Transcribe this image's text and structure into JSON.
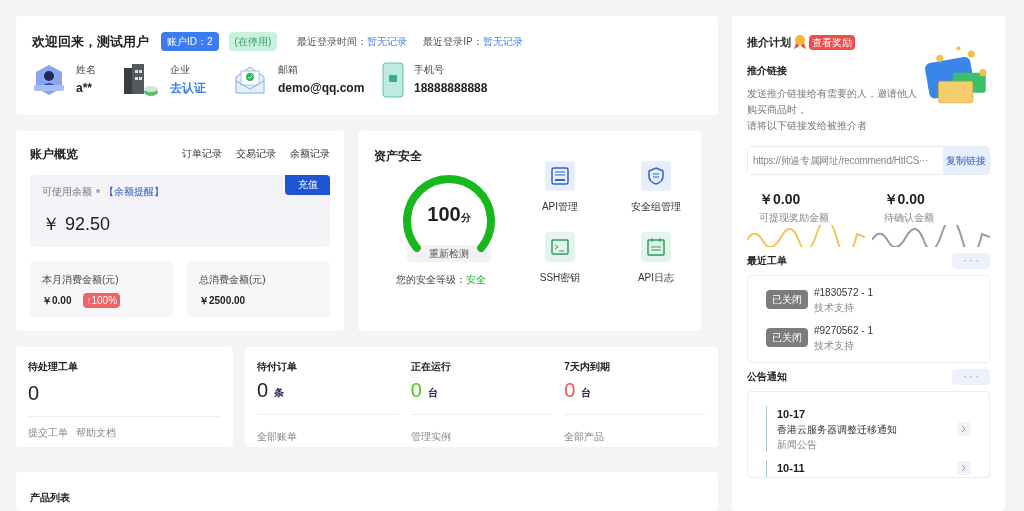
{
  "welcome": {
    "title": "欢迎回来，测试用户",
    "account_id": "账户ID：2",
    "status_badge": "(在停用)",
    "login_time_label": "最近登录时间：",
    "login_time": "暂无记录",
    "login_ip_label": "最近登录IP：",
    "login_ip": "暂无记录"
  },
  "profile": [
    {
      "kind": "user",
      "label": "姓名",
      "value": "a**",
      "link": false
    },
    {
      "kind": "company",
      "label": "企业",
      "value": "去认证",
      "link": true
    },
    {
      "kind": "mail",
      "label": "邮箱",
      "value": "demo@qq.com",
      "link": false
    },
    {
      "kind": "phone",
      "label": "手机号",
      "value": "18888888888",
      "link": false
    }
  ],
  "account": {
    "title": "账户概览",
    "tabs": [
      "订单记录",
      "交易记录",
      "余额记录"
    ],
    "balance_label": "可使用余额",
    "reminder": "【余额提醒】",
    "recharge": "充值",
    "balance": "￥ 92.50",
    "stats": [
      {
        "label": "本月消费金额(元)",
        "value": "￥0.00",
        "badge": "↑100%"
      },
      {
        "label": "总消费金额(元)",
        "value": "￥2500.00"
      }
    ]
  },
  "security": {
    "title": "资产安全",
    "score": "100",
    "unit": "分",
    "level": 1,
    "recheck": "重新检测",
    "grade_label": "您的安全等级：",
    "grade": "安全",
    "tools": [
      {
        "kind": "api",
        "label": "API管理"
      },
      {
        "kind": "shield",
        "label": "安全组管理"
      },
      {
        "kind": "terminal",
        "label": "SSH密钥"
      },
      {
        "kind": "log",
        "label": "API日志"
      }
    ]
  },
  "pending_tickets": {
    "title": "待处理工单",
    "count": "0",
    "links": [
      "提交工单",
      "帮助文档"
    ]
  },
  "summary": [
    {
      "title": "待付订单",
      "count": "0",
      "unit": "条",
      "color": "#222222",
      "link": "全部账单"
    },
    {
      "title": "正在运行",
      "count": "0",
      "unit": "台",
      "color": "#52c41a",
      "link": "管理实例"
    },
    {
      "title": "7天内到期",
      "count": "0",
      "unit": "台",
      "color": "#f0505a",
      "link": "全部产品"
    }
  ],
  "products": {
    "title": "产品列表"
  },
  "referral": {
    "title": "推介计划",
    "reward": "查看奖励",
    "link_title": "推介链接",
    "description": [
      "发送推介链接给有需要的人，邀请他人",
      "购买商品时，",
      "请将以下链接发给被推介者"
    ],
    "url": "https://帅逼专属网址/recommend/HtICS···",
    "copy": "复制链接",
    "amounts": [
      {
        "value": "￥0.00",
        "label": "可提现奖励金额",
        "color": "#f3c65c"
      },
      {
        "value": "￥0.00",
        "label": "待确认金额",
        "color": "#9a9aa6"
      }
    ]
  },
  "recent_tickets": {
    "title": "最近工单",
    "more": "· · ·",
    "items": [
      {
        "status": "已关闭",
        "number": "#1830572 - 1",
        "category": "技术支持"
      },
      {
        "status": "已关闭",
        "number": "#9270562 - 1",
        "category": "技术支持"
      }
    ]
  },
  "notices": {
    "title": "公告通知",
    "more": "· · ·",
    "items": [
      {
        "date": "10-17",
        "title": "香港云服务器调整迁移通知",
        "category": "新闻公告"
      },
      {
        "date": "10-11"
      }
    ]
  }
}
